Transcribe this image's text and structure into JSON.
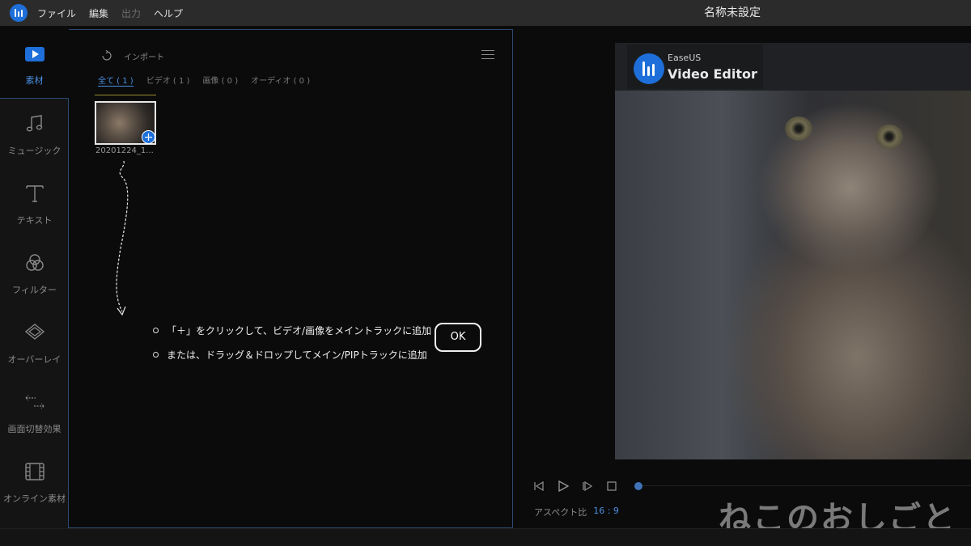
{
  "titlebar": {
    "menu": [
      "ファイル",
      "編集",
      "出力",
      "ヘルプ"
    ],
    "menu_disabled": [
      false,
      false,
      true,
      false
    ],
    "title": "名称未設定"
  },
  "sidebar": {
    "items": [
      {
        "label": "素材",
        "icon": "media-play-icon",
        "active": true
      },
      {
        "label": "ミュージック",
        "icon": "music-note-icon",
        "active": false
      },
      {
        "label": "テキスト",
        "icon": "text-t-icon",
        "active": false
      },
      {
        "label": "フィルター",
        "icon": "filter-circles-icon",
        "active": false
      },
      {
        "label": "オーバーレイ",
        "icon": "overlay-diamond-icon",
        "active": false
      },
      {
        "label": "画面切替効果",
        "icon": "transition-arrows-icon",
        "active": false
      },
      {
        "label": "オンライン素材",
        "icon": "film-strip-icon",
        "active": false
      }
    ]
  },
  "media": {
    "import_label": "インポート",
    "tabs": [
      {
        "label": "全て ( 1 )",
        "active": true
      },
      {
        "label": "ビデオ ( 1 )",
        "active": false
      },
      {
        "label": "画像 ( 0 )",
        "active": false
      },
      {
        "label": "オーディオ ( 0 )",
        "active": false
      }
    ],
    "thumb_label": "20201224_1...",
    "hints": [
      "「＋」をクリックして、ビデオ/画像をメイントラックに追加",
      "または、ドラッグ＆ドロップしてメイン/PIPトラックに追加"
    ],
    "ok_label": "OK"
  },
  "preview": {
    "brand_small": "EaseUS",
    "brand_big": "Video Editor",
    "aspect_label": "アスペクト比",
    "aspect_value": "16 : 9"
  },
  "watermark": "ねこのおしごと",
  "colors": {
    "accent": "#1e6fd9",
    "active_text": "#4a8fe0",
    "panel_border": "#2e4a72"
  }
}
